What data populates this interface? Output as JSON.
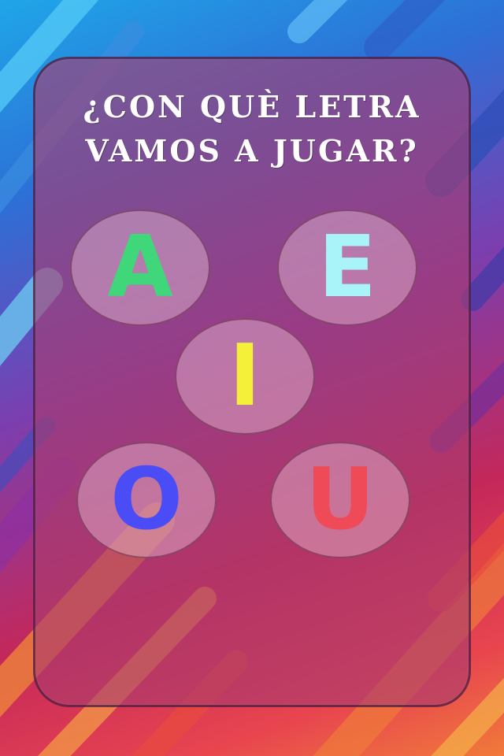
{
  "title": {
    "line1": "¿Con què letra",
    "line2": "vamos a jugar?"
  },
  "vowels": [
    {
      "letter": "A",
      "color": "#3fd77a"
    },
    {
      "letter": "E",
      "color": "#a8f4f8"
    },
    {
      "letter": "I",
      "color": "#f4f03a"
    },
    {
      "letter": "O",
      "color": "#4a4cf5"
    },
    {
      "letter": "U",
      "color": "#ee4a57"
    }
  ]
}
